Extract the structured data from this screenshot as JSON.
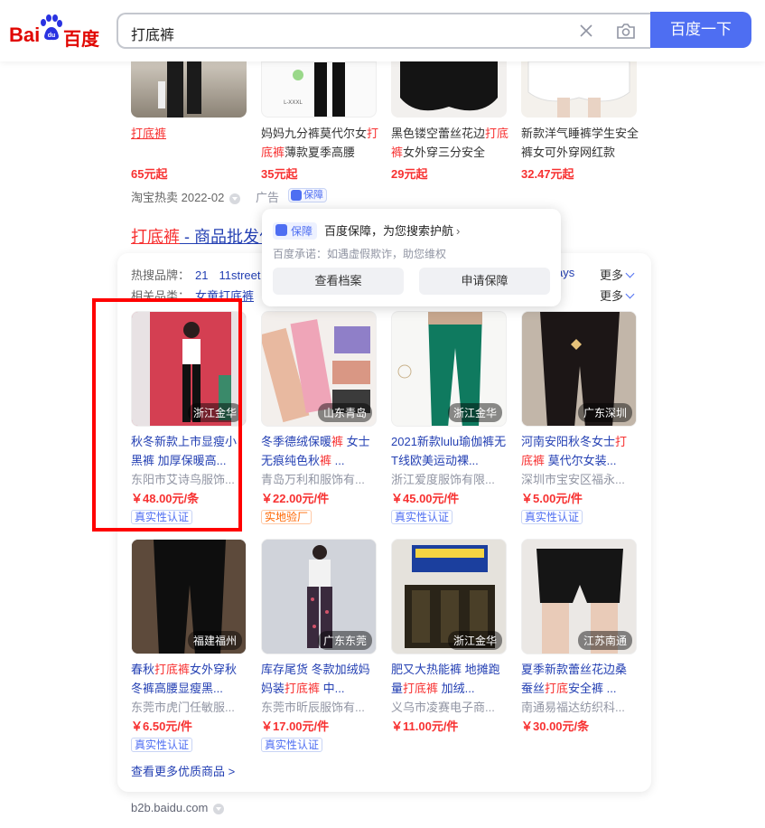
{
  "header": {
    "logo_left": "Bai",
    "logo_right": "百度",
    "query": "打底裤",
    "search_button": "百度一下"
  },
  "top_products": [
    {
      "title_plain": "",
      "title_red": "打底裤",
      "title_rest": "",
      "price": "65元起"
    },
    {
      "title_plain": "妈妈九分裤莫代尔女",
      "title_red": "打底裤",
      "title_rest": "薄款夏季高腰",
      "price": "35元起"
    },
    {
      "title_plain": "黑色镂空蕾丝花边",
      "title_red": "打底裤",
      "title_rest": "女外穿三分安全",
      "price": "29元起"
    },
    {
      "title_plain": "新款洋气睡裤学生安全裤女可外穿网红款",
      "title_red": "",
      "title_rest": "",
      "price": "32.47元起"
    }
  ],
  "meta": {
    "source": "淘宝热卖 2022-02",
    "ad": "广告",
    "guarantee": "保障"
  },
  "popup": {
    "badge": "保障",
    "headline": "百度保障，为您搜索护航",
    "promise": "百度承诺：如遇虚假欺诈，助您维权",
    "btn_profile": "查看档案",
    "btn_apply": "申请保障"
  },
  "b2b": {
    "title_red": "打底裤",
    "title_rest": " - 商品批发价",
    "hot_label": "热搜品牌：",
    "hot_items": [
      "21",
      "11street"
    ],
    "hot_tail": "ays",
    "related_label": "相关品类：",
    "related_items": [
      "女童打底裤"
    ],
    "more1": "更多",
    "more2": "更多",
    "see_more": "查看更多优质商品 >",
    "footer_url": "b2b.baidu.com"
  },
  "tiles": [
    {
      "loc": "浙江金华",
      "title_html": [
        "秋冬新款上市显瘦小黑裤 加厚保暖高..."
      ],
      "seller": "东阳市艾诗鸟服饰...",
      "price": "￥48.00元/条",
      "cert": "真实性认证",
      "cert_style": "blue"
    },
    {
      "loc": "山东青岛",
      "title_html": [
        "冬季德绒保暖",
        "裤",
        " 女士无痕纯色秋",
        "裤",
        " ..."
      ],
      "seller": "青岛万利和服饰有...",
      "price": "￥22.00元/件",
      "cert": "实地验厂",
      "cert_style": "orange"
    },
    {
      "loc": "浙江金华",
      "title_html": [
        "2021新款lulu瑜伽裤无T线欧美运动裸..."
      ],
      "seller": "浙江爱度服饰有限...",
      "price": "￥45.00元/件",
      "cert": "真实性认证",
      "cert_style": "blue"
    },
    {
      "loc": "广东深圳",
      "title_html": [
        "河南安阳秋冬女士",
        "打底裤",
        " 莫代尔女装..."
      ],
      "seller": "深圳市宝安区福永...",
      "price": "￥5.00元/件",
      "cert": "真实性认证",
      "cert_style": "blue"
    },
    {
      "loc": "福建福州",
      "title_html": [
        "春秋",
        "打底裤",
        "女外穿秋冬裤高腰显瘦黑..."
      ],
      "seller": "东莞市虎门任敏服...",
      "price": "￥6.50元/件",
      "cert": "真实性认证",
      "cert_style": "blue"
    },
    {
      "loc": "广东东莞",
      "title_html": [
        "库存尾货 冬款加绒妈妈装",
        "打底裤",
        " 中..."
      ],
      "seller": "东莞市昕辰服饰有...",
      "price": "￥17.00元/件",
      "cert": "真实性认证",
      "cert_style": "blue"
    },
    {
      "loc": "浙江金华",
      "title_html": [
        "肥又大热能裤 地摊跑量",
        "打底裤",
        " 加绒..."
      ],
      "seller": "义乌市凌赛电子商...",
      "price": "￥11.00元/件",
      "cert": "",
      "cert_style": "none"
    },
    {
      "loc": "江苏南通",
      "title_html": [
        "夏季新款蕾丝花边桑蚕丝",
        "打底",
        "安全裤 ..."
      ],
      "seller": "南通易福达纺织科...",
      "price": "￥30.00元/条",
      "cert": "",
      "cert_style": "none"
    }
  ],
  "colors": {
    "brand": "#4e6ef2",
    "red": "#f73131",
    "link": "#2440b3"
  }
}
